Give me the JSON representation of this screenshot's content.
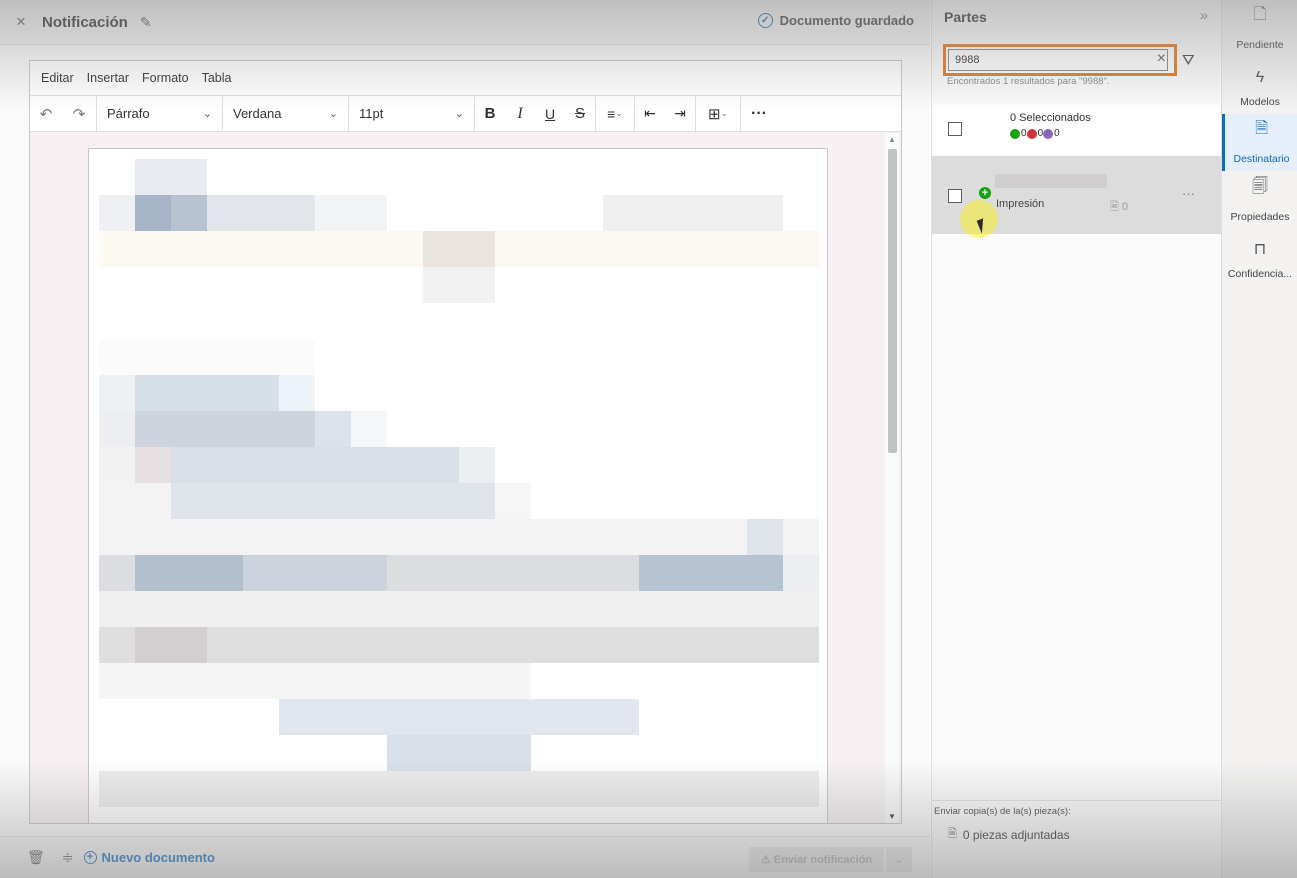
{
  "header": {
    "close_glyph": "×",
    "title": "Notificación",
    "saved_status": "Documento guardado"
  },
  "editor": {
    "menu": [
      "Editar",
      "Insertar",
      "Formato",
      "Tabla"
    ],
    "block_format": "Párrafo",
    "font_family": "Verdana",
    "font_size": "11pt"
  },
  "footer": {
    "new_document": "Nuevo documento",
    "send_notification": "⚠ Enviar notificación"
  },
  "parties": {
    "title": "Partes",
    "search_value": "9988",
    "results_text": "Encontrados 1 resultados para \"9988\".",
    "selected_label": "0 Seleccionados",
    "stats": {
      "added": "0",
      "removed": "0",
      "other": "0"
    },
    "party": {
      "type": "Impresión",
      "pieces": "0"
    },
    "copies_label": "Enviar copia(s) de la(s) pieza(s):",
    "attached_pieces": "0 piezas adjuntadas"
  },
  "rail": {
    "items": [
      {
        "label": "Pendiente",
        "icon": "clock-document-icon"
      },
      {
        "label": "Modelos",
        "icon": "lightning-icon"
      },
      {
        "label": "Destinatario",
        "icon": "recipient-document-icon",
        "active": true
      },
      {
        "label": "Propiedades",
        "icon": "properties-document-icon"
      },
      {
        "label": "Confidencia...",
        "icon": "lock-icon"
      }
    ]
  },
  "colors": {
    "accent": "#0f6cbd",
    "highlight_border": "#e7781e",
    "stat_added": "#13a10e",
    "stat_removed": "#d13438",
    "stat_other": "#8764b8"
  }
}
